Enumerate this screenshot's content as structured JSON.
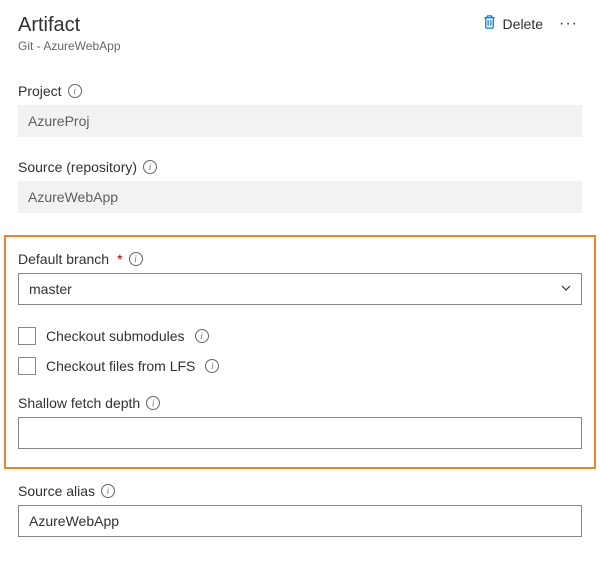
{
  "header": {
    "title": "Artifact",
    "subtitle": "Git - AzureWebApp",
    "delete_label": "Delete"
  },
  "fields": {
    "project": {
      "label": "Project",
      "value": "AzureProj"
    },
    "source_repo": {
      "label": "Source (repository)",
      "value": "AzureWebApp"
    },
    "default_branch": {
      "label": "Default branch",
      "value": "master"
    },
    "checkout_submodules": {
      "label": "Checkout submodules"
    },
    "checkout_lfs": {
      "label": "Checkout files from LFS"
    },
    "shallow_fetch": {
      "label": "Shallow fetch depth",
      "value": ""
    },
    "source_alias": {
      "label": "Source alias",
      "value": "AzureWebApp"
    }
  }
}
